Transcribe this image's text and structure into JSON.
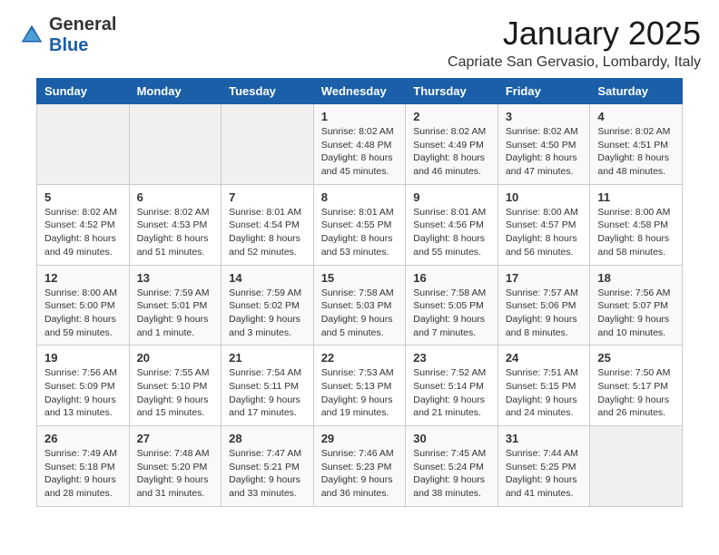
{
  "header": {
    "logo_general": "General",
    "logo_blue": "Blue",
    "month_title": "January 2025",
    "location": "Capriate San Gervasio, Lombardy, Italy"
  },
  "weekdays": [
    "Sunday",
    "Monday",
    "Tuesday",
    "Wednesday",
    "Thursday",
    "Friday",
    "Saturday"
  ],
  "weeks": [
    [
      {
        "day": "",
        "info": ""
      },
      {
        "day": "",
        "info": ""
      },
      {
        "day": "",
        "info": ""
      },
      {
        "day": "1",
        "info": "Sunrise: 8:02 AM\nSunset: 4:48 PM\nDaylight: 8 hours and 45 minutes."
      },
      {
        "day": "2",
        "info": "Sunrise: 8:02 AM\nSunset: 4:49 PM\nDaylight: 8 hours and 46 minutes."
      },
      {
        "day": "3",
        "info": "Sunrise: 8:02 AM\nSunset: 4:50 PM\nDaylight: 8 hours and 47 minutes."
      },
      {
        "day": "4",
        "info": "Sunrise: 8:02 AM\nSunset: 4:51 PM\nDaylight: 8 hours and 48 minutes."
      }
    ],
    [
      {
        "day": "5",
        "info": "Sunrise: 8:02 AM\nSunset: 4:52 PM\nDaylight: 8 hours and 49 minutes."
      },
      {
        "day": "6",
        "info": "Sunrise: 8:02 AM\nSunset: 4:53 PM\nDaylight: 8 hours and 51 minutes."
      },
      {
        "day": "7",
        "info": "Sunrise: 8:01 AM\nSunset: 4:54 PM\nDaylight: 8 hours and 52 minutes."
      },
      {
        "day": "8",
        "info": "Sunrise: 8:01 AM\nSunset: 4:55 PM\nDaylight: 8 hours and 53 minutes."
      },
      {
        "day": "9",
        "info": "Sunrise: 8:01 AM\nSunset: 4:56 PM\nDaylight: 8 hours and 55 minutes."
      },
      {
        "day": "10",
        "info": "Sunrise: 8:00 AM\nSunset: 4:57 PM\nDaylight: 8 hours and 56 minutes."
      },
      {
        "day": "11",
        "info": "Sunrise: 8:00 AM\nSunset: 4:58 PM\nDaylight: 8 hours and 58 minutes."
      }
    ],
    [
      {
        "day": "12",
        "info": "Sunrise: 8:00 AM\nSunset: 5:00 PM\nDaylight: 8 hours and 59 minutes."
      },
      {
        "day": "13",
        "info": "Sunrise: 7:59 AM\nSunset: 5:01 PM\nDaylight: 9 hours and 1 minute."
      },
      {
        "day": "14",
        "info": "Sunrise: 7:59 AM\nSunset: 5:02 PM\nDaylight: 9 hours and 3 minutes."
      },
      {
        "day": "15",
        "info": "Sunrise: 7:58 AM\nSunset: 5:03 PM\nDaylight: 9 hours and 5 minutes."
      },
      {
        "day": "16",
        "info": "Sunrise: 7:58 AM\nSunset: 5:05 PM\nDaylight: 9 hours and 7 minutes."
      },
      {
        "day": "17",
        "info": "Sunrise: 7:57 AM\nSunset: 5:06 PM\nDaylight: 9 hours and 8 minutes."
      },
      {
        "day": "18",
        "info": "Sunrise: 7:56 AM\nSunset: 5:07 PM\nDaylight: 9 hours and 10 minutes."
      }
    ],
    [
      {
        "day": "19",
        "info": "Sunrise: 7:56 AM\nSunset: 5:09 PM\nDaylight: 9 hours and 13 minutes."
      },
      {
        "day": "20",
        "info": "Sunrise: 7:55 AM\nSunset: 5:10 PM\nDaylight: 9 hours and 15 minutes."
      },
      {
        "day": "21",
        "info": "Sunrise: 7:54 AM\nSunset: 5:11 PM\nDaylight: 9 hours and 17 minutes."
      },
      {
        "day": "22",
        "info": "Sunrise: 7:53 AM\nSunset: 5:13 PM\nDaylight: 9 hours and 19 minutes."
      },
      {
        "day": "23",
        "info": "Sunrise: 7:52 AM\nSunset: 5:14 PM\nDaylight: 9 hours and 21 minutes."
      },
      {
        "day": "24",
        "info": "Sunrise: 7:51 AM\nSunset: 5:15 PM\nDaylight: 9 hours and 24 minutes."
      },
      {
        "day": "25",
        "info": "Sunrise: 7:50 AM\nSunset: 5:17 PM\nDaylight: 9 hours and 26 minutes."
      }
    ],
    [
      {
        "day": "26",
        "info": "Sunrise: 7:49 AM\nSunset: 5:18 PM\nDaylight: 9 hours and 28 minutes."
      },
      {
        "day": "27",
        "info": "Sunrise: 7:48 AM\nSunset: 5:20 PM\nDaylight: 9 hours and 31 minutes."
      },
      {
        "day": "28",
        "info": "Sunrise: 7:47 AM\nSunset: 5:21 PM\nDaylight: 9 hours and 33 minutes."
      },
      {
        "day": "29",
        "info": "Sunrise: 7:46 AM\nSunset: 5:23 PM\nDaylight: 9 hours and 36 minutes."
      },
      {
        "day": "30",
        "info": "Sunrise: 7:45 AM\nSunset: 5:24 PM\nDaylight: 9 hours and 38 minutes."
      },
      {
        "day": "31",
        "info": "Sunrise: 7:44 AM\nSunset: 5:25 PM\nDaylight: 9 hours and 41 minutes."
      },
      {
        "day": "",
        "info": ""
      }
    ]
  ]
}
